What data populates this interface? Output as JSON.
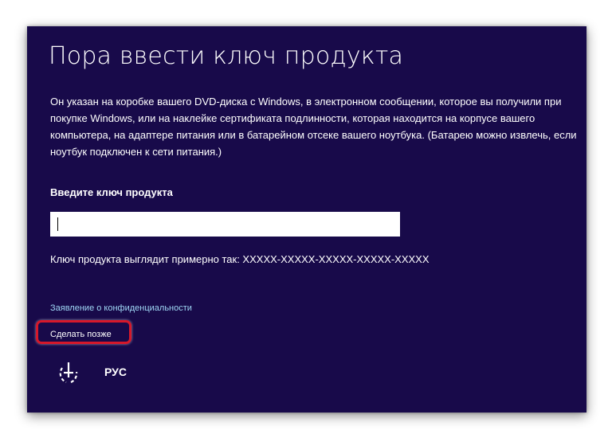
{
  "window": {
    "title": "Пора ввести ключ продукта",
    "description": "Он указан на коробке вашего DVD-диска с Windows, в электронном сообщении, которое вы получили при покупке Windows, или на наклейке сертификата подлинности, которая находится на корпусе вашего компьютера, на адаптере питания или в батарейном отсеке вашего ноутбука. (Батарею можно извлечь, если ноутбук подключен к сети питания.)",
    "key_label": "Введите ключ продукта",
    "key_input_value": "",
    "key_example": "Ключ продукта выглядит примерно так: XXXXX-XXXXX-XXXXX-XXXXX-XXXXX",
    "privacy_link": "Заявление о конфиденциальности",
    "later_link": "Сделать позже",
    "language": "РУС",
    "ease_of_access_icon": "ease-of-access-icon"
  },
  "colors": {
    "background": "#180a4a",
    "text": "#ffffff",
    "link": "#9fd7f5",
    "highlight": "#d6182a"
  }
}
